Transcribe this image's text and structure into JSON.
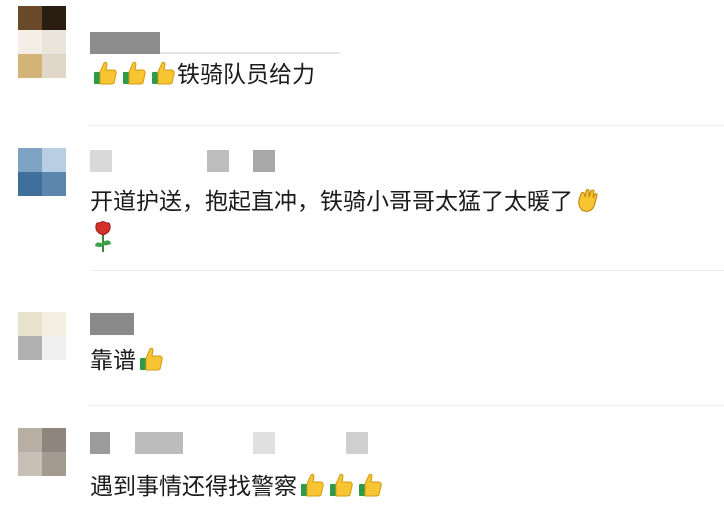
{
  "comments": [
    {
      "text": "铁骑队员给力",
      "emoji_before": [
        "thumbs-up-icon",
        "thumbs-up-icon",
        "thumbs-up-icon"
      ],
      "emoji_after": [],
      "avatar_colors": [
        "#6b4a2c",
        "#2a1d12",
        "#f3efe6",
        "#e9e4dc",
        "#d3b377",
        "#e1d7c9"
      ],
      "name_blur_colors": [
        "#8d8d8d"
      ]
    },
    {
      "text": "开道护送，抱起直冲，铁骑小哥哥太猛了太暖了",
      "emoji_before": [],
      "emoji_after": [
        "clapping-hand-icon",
        "rose-icon"
      ],
      "avatar_colors": [
        "#7fa3c4",
        "#b7cee3",
        "#3f6f9a",
        "#5d86ae"
      ],
      "name_blur_colors": [
        "#d9d9d9",
        "#bdbdbd",
        "#a8a8a8"
      ]
    },
    {
      "text": "靠谱",
      "emoji_before": [],
      "emoji_after": [
        "thumbs-up-icon"
      ],
      "avatar_colors": [
        "#e9e2cf",
        "#f5efe3",
        "#b0b0b0",
        "#f0f0f0"
      ],
      "name_blur_colors": [
        "#8a8a8a"
      ]
    },
    {
      "text": "遇到事情还得找警察",
      "emoji_before": [],
      "emoji_after": [
        "thumbs-up-icon",
        "thumbs-up-icon",
        "thumbs-up-icon"
      ],
      "avatar_colors": [
        "#b9aea4",
        "#8f857d",
        "#c8c0b6",
        "#a49a90"
      ],
      "name_blur_colors": [
        "#9b9b9b",
        "#bcbcbc",
        "#e0e0e0",
        "#cfcfcf"
      ]
    }
  ]
}
